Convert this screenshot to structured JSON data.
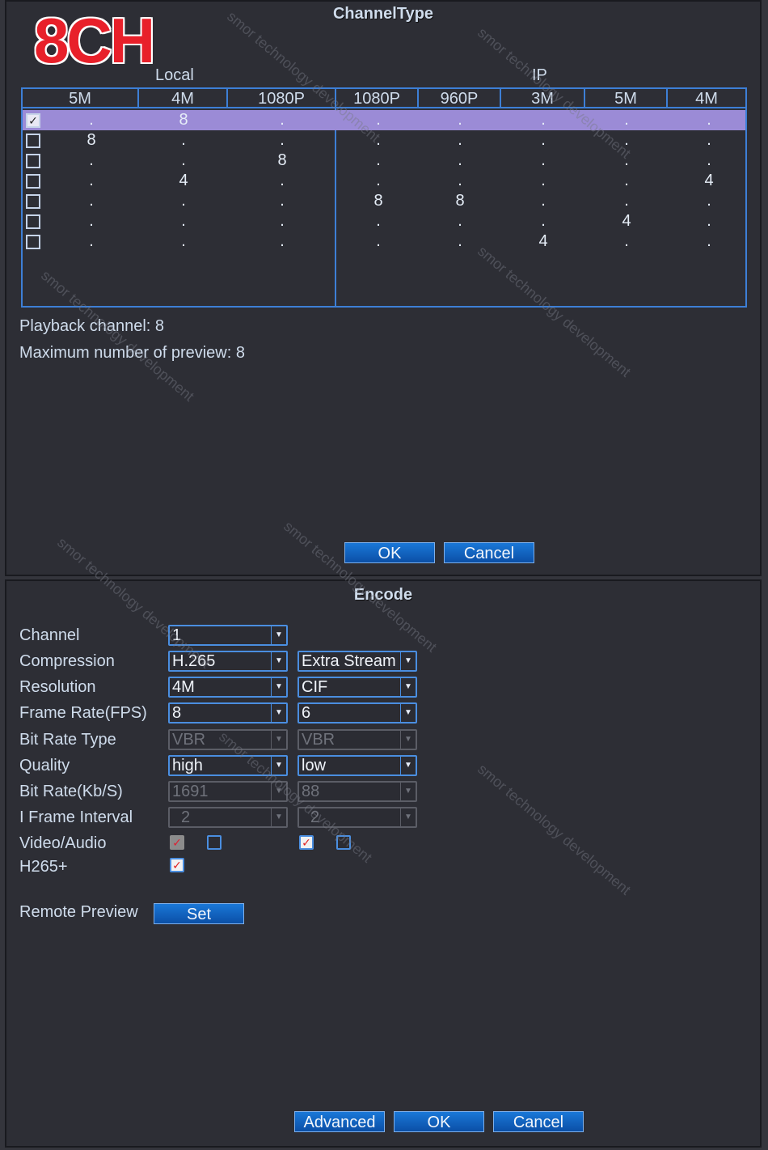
{
  "channel_type": {
    "title": "ChannelType",
    "badge": "8CH",
    "local_label": "Local",
    "ip_label": "IP",
    "columns": [
      "5M",
      "4M",
      "1080P",
      "1080P",
      "960P",
      "3M",
      "5M",
      "4M"
    ],
    "rows": [
      {
        "checked": true,
        "selected": true,
        "values": [
          ".",
          "8",
          ".",
          ".",
          ".",
          ".",
          ".",
          "."
        ]
      },
      {
        "checked": false,
        "selected": false,
        "values": [
          "8",
          ".",
          ".",
          ".",
          ".",
          ".",
          ".",
          "."
        ]
      },
      {
        "checked": false,
        "selected": false,
        "values": [
          ".",
          ".",
          "8",
          ".",
          ".",
          ".",
          ".",
          "."
        ]
      },
      {
        "checked": false,
        "selected": false,
        "values": [
          ".",
          "4",
          ".",
          ".",
          ".",
          ".",
          ".",
          "4"
        ]
      },
      {
        "checked": false,
        "selected": false,
        "values": [
          ".",
          ".",
          ".",
          "8",
          "8",
          ".",
          ".",
          "."
        ]
      },
      {
        "checked": false,
        "selected": false,
        "values": [
          ".",
          ".",
          ".",
          ".",
          ".",
          ".",
          "4",
          "."
        ]
      },
      {
        "checked": false,
        "selected": false,
        "values": [
          ".",
          ".",
          ".",
          ".",
          ".",
          "4",
          ".",
          "."
        ]
      }
    ],
    "playback": "Playback channel: 8",
    "max_preview": "Maximum number of preview: 8",
    "ok_label": "OK",
    "cancel_label": "Cancel"
  },
  "encode": {
    "title": "Encode",
    "labels": {
      "channel": "Channel",
      "compression": "Compression",
      "resolution": "Resolution",
      "frame_rate": "Frame Rate(FPS)",
      "bit_rate_type": "Bit Rate Type",
      "quality": "Quality",
      "bit_rate": "Bit Rate(Kb/S)",
      "iframe": "I Frame Interval",
      "video_audio": "Video/Audio",
      "h265plus": "H265+",
      "remote_preview": "Remote Preview"
    },
    "main": {
      "channel": "1",
      "compression": "H.265",
      "resolution": "4M",
      "frame_rate": "8",
      "bit_rate_type": "VBR",
      "quality": "high",
      "bit_rate": "1691",
      "iframe": "2"
    },
    "extra": {
      "stream": "Extra Stream",
      "resolution": "CIF",
      "frame_rate": "6",
      "bit_rate_type": "VBR",
      "quality": "low",
      "bit_rate": "88",
      "iframe": "2"
    },
    "set_label": "Set",
    "advanced_label": "Advanced",
    "ok_label": "OK",
    "cancel_label": "Cancel",
    "check_glyph": "✓",
    "arrow_glyph": "▼"
  },
  "watermark": "smor technology development"
}
